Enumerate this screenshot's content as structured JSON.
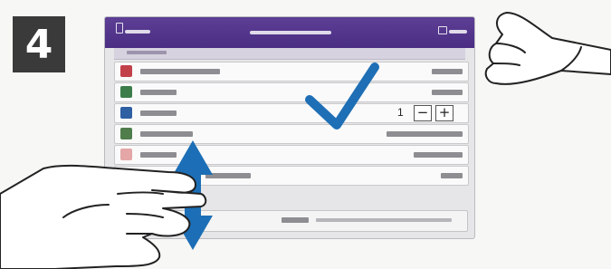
{
  "step": {
    "number": "4"
  },
  "screen": {
    "header": {
      "title": ""
    },
    "quantity": {
      "value": "1",
      "minus_label": "−",
      "plus_label": "+"
    },
    "footer_button": {
      "label": ""
    }
  },
  "colors": {
    "header_purple": "#4a2e83",
    "checkmark_blue": "#1e6fb5",
    "arrow_blue": "#1c6fb6"
  }
}
